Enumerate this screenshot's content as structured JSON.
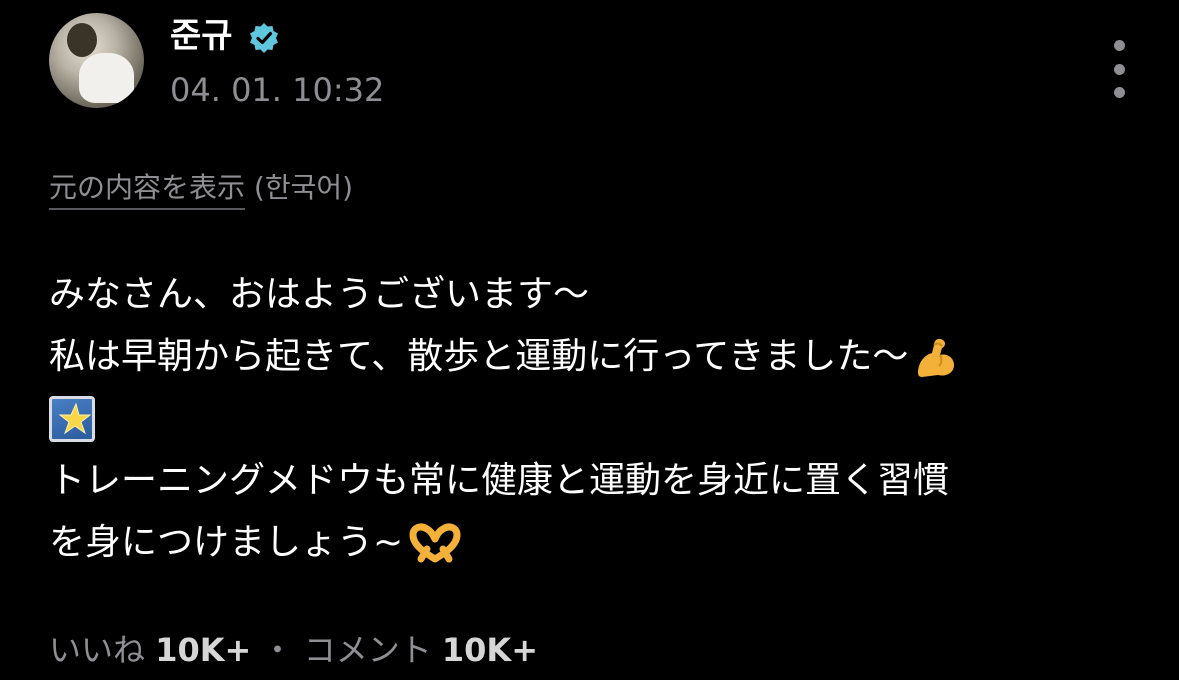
{
  "post": {
    "author": "준규",
    "timestamp": "04. 01. 10:32",
    "show_original_label": "元の内容を表示",
    "original_language": "(한국어)",
    "lines": [
      "みなさん、おはようございます〜",
      "私は早朝から起きて、散歩と運動に行ってきました〜",
      "",
      "トレーニングメドウも常に健康と運動を身近に置く習慣",
      "を身につけましょう~"
    ],
    "emojis": {
      "line2": "flexed-biceps",
      "line3": "glowing-star",
      "line5": "heart-hands"
    }
  },
  "footer": {
    "likes_label": "いいね",
    "likes_count": "10K+",
    "separator": "・",
    "comments_label": "コメント",
    "comments_count": "10K+"
  },
  "colors": {
    "background": "#000000",
    "text": "#ffffff",
    "muted": "#8e8e93",
    "verified": "#5ec7dd"
  }
}
